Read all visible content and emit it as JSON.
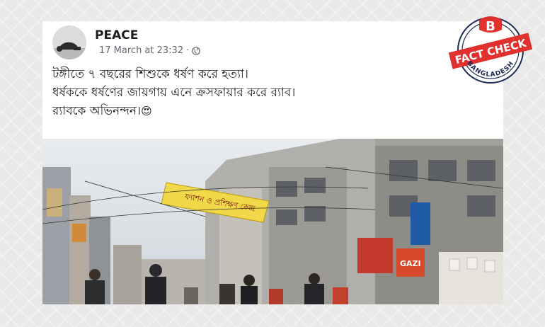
{
  "post": {
    "author": "PEACE",
    "timestamp": "17 March at 23:32",
    "separator": "·",
    "privacy_icon": "globe-icon",
    "lines": [
      "টঙ্গীতে ৭ বছরের শিশুকে ধর্ষণ করে হত্যা।",
      "ধর্ষককে ধর্ষণের জায়গায় এনে ক্রসফায়ার করে র‍্যাব।",
      "র‍্যাবকে অভিনন্দন।"
    ],
    "emoji": "😍"
  },
  "photo": {
    "banner_text": "ফ্যাশন ও প্রশিক্ষণ কেন্দ্র",
    "sign_text": "GAZI"
  },
  "badge": {
    "letter": "B",
    "top_text": "FACT CHECK",
    "bottom_text": "BANGLADESH",
    "colors": {
      "red": "#e0312f",
      "navy": "#1a2a55"
    }
  }
}
